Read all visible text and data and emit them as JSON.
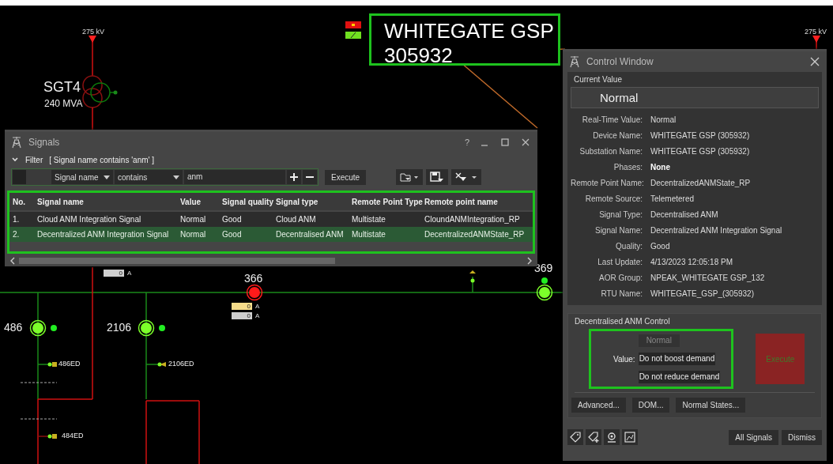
{
  "diagram": {
    "voltage_labels": [
      "275 kV",
      "275 kV"
    ],
    "transformer": {
      "name": "SGT4",
      "rating": "240 MVA"
    },
    "breakers": [
      {
        "label": "486",
        "color": "#7cff2a"
      },
      {
        "label": "2106",
        "color": "#7cff2a"
      },
      {
        "label": "366",
        "color": "#ff1a1a"
      },
      {
        "label": "369",
        "color": "#7cff2a"
      }
    ],
    "feeders": [
      "486ED",
      "2106ED",
      "484ED"
    ],
    "current_readings": [
      {
        "value": "0",
        "unit": "A"
      },
      {
        "value": "0",
        "unit": "A"
      },
      {
        "value": "0",
        "unit": "A"
      }
    ]
  },
  "title_box": {
    "name": "WHITEGATE GSP",
    "number": "305932",
    "highlighted": true
  },
  "signals_window": {
    "title": "Signals",
    "help": "?",
    "filter": {
      "expanded": true,
      "checked": false,
      "label": "Filter",
      "summary": "[ Signal name contains 'anm' ]",
      "field": "Signal name",
      "operator": "contains",
      "value": "anm",
      "execute": "Execute"
    },
    "table": {
      "highlighted": true,
      "columns": [
        "No.",
        "Signal name",
        "Value",
        "Signal quality",
        "Signal type",
        "Remote Point Type",
        "Remote point name"
      ],
      "rows": [
        {
          "cells": [
            "1.",
            "Cloud ANM Integration Signal",
            "Normal",
            "Good",
            "Cloud ANM",
            "Multistate",
            "CloundANMIntegration_RP"
          ],
          "selected": false
        },
        {
          "cells": [
            "2.",
            "Decentralized ANM Integration Signal",
            "Normal",
            "Good",
            "Decentralised ANM",
            "Multistate",
            "DecentralizedANMState_RP"
          ],
          "selected": true
        }
      ]
    }
  },
  "control_window": {
    "title": "Control Window",
    "current_value_label": "Current Value",
    "current_value": "Normal",
    "fields": [
      {
        "label": "Real-Time Value:",
        "value": "Normal",
        "strong": false
      },
      {
        "label": "Device Name:",
        "value": "WHITEGATE GSP (305932)",
        "strong": false
      },
      {
        "label": "Substation Name:",
        "value": "WHITEGATE GSP (305932)",
        "strong": false
      },
      {
        "label": "Phases:",
        "value": "None",
        "strong": true
      },
      {
        "label": "Remote Point Name:",
        "value": "DecentralizedANMState_RP",
        "strong": false
      },
      {
        "label": "Remote Source:",
        "value": "Telemetered",
        "strong": false
      },
      {
        "label": "Signal Type:",
        "value": "Decentralised ANM",
        "strong": false
      },
      {
        "label": "Signal Name:",
        "value": "Decentralized ANM Integration Signal",
        "strong": false
      },
      {
        "label": "Quality:",
        "value": "Good",
        "strong": false
      },
      {
        "label": "Last Update:",
        "value": "4/13/2023 12:05:18 PM",
        "strong": false
      },
      {
        "label": "AOR Group:",
        "value": "NPEAK_WHITEGATE GSP_132",
        "strong": false
      },
      {
        "label": "RTU Name:",
        "value": "WHITEGATE_GSP_(305932)",
        "strong": false
      }
    ],
    "control": {
      "title": "Decentralised ANM Control",
      "value_label": "Value:",
      "highlighted": true,
      "options": [
        {
          "label": "Normal",
          "disabled": true
        },
        {
          "label": "Do not boost demand",
          "disabled": false
        },
        {
          "label": "Do not reduce demand",
          "disabled": false
        }
      ],
      "execute": {
        "label": "Execute",
        "disabled": true
      }
    },
    "buttons": [
      "Advanced...",
      "DOM...",
      "Normal States..."
    ],
    "footer_buttons": [
      "All Signals",
      "Dismiss"
    ]
  }
}
